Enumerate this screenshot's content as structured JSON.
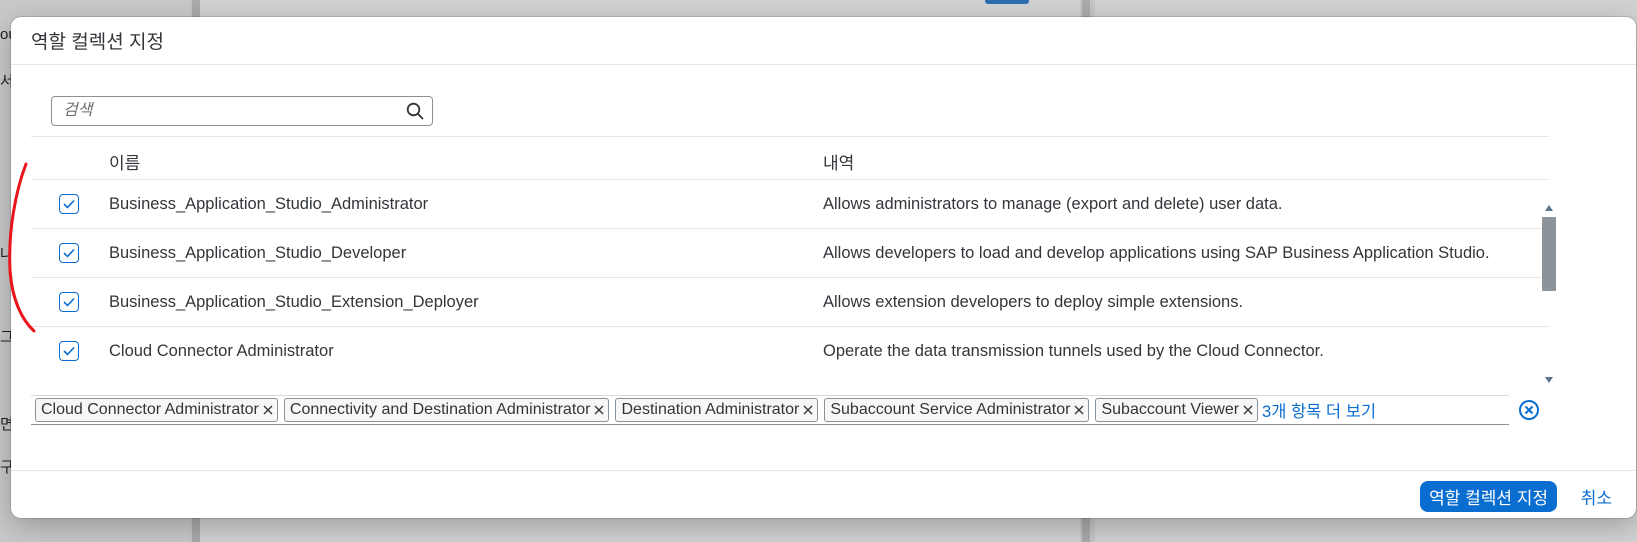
{
  "background": {
    "fragments": [
      "ou",
      "서",
      "나",
      "그",
      "면",
      "구"
    ]
  },
  "dialog": {
    "title": "역할 컬렉션 지정",
    "search": {
      "placeholder": "검색",
      "value": ""
    },
    "table": {
      "columns": {
        "name": "이름",
        "description": "내역"
      },
      "rows": [
        {
          "checked": true,
          "name": "Business_Application_Studio_Administrator",
          "description": "Allows administrators to manage (export and delete) user data."
        },
        {
          "checked": true,
          "name": "Business_Application_Studio_Developer",
          "description": "Allows developers to load and develop applications using SAP Business Application Studio."
        },
        {
          "checked": true,
          "name": "Business_Application_Studio_Extension_Deployer",
          "description": "Allows extension developers to deploy simple extensions."
        },
        {
          "checked": true,
          "name": "Cloud Connector Administrator",
          "description": "Operate the data transmission tunnels used by the Cloud Connector."
        }
      ]
    },
    "tokens": [
      "Cloud Connector Administrator",
      "Connectivity and Destination Administrator",
      "Destination Administrator",
      "Subaccount Service Administrator",
      "Subaccount Viewer"
    ],
    "more_tokens_link": "3개 항목 더 보기",
    "footer": {
      "primary_label": "역할 컬렉션 지정",
      "cancel_label": "취소"
    }
  },
  "colors": {
    "accent": "#0a6ed1",
    "annotation": "#e8161b"
  }
}
